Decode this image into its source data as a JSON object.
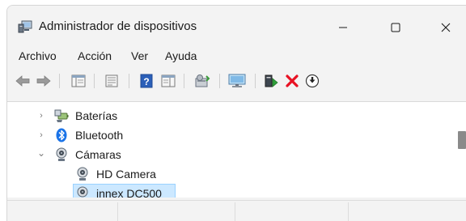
{
  "window": {
    "title": "Administrador de dispositivos"
  },
  "menu": [
    "Archivo",
    "Acción",
    "Ver",
    "Ayuda"
  ],
  "toolbar": {
    "buttons": [
      {
        "icon": "back-arrow-icon"
      },
      {
        "icon": "forward-arrow-icon"
      },
      {
        "icon": "show-hide-console-tree-icon"
      },
      {
        "icon": "properties-icon"
      },
      {
        "icon": "help-icon"
      },
      {
        "icon": "action-pane-icon"
      },
      {
        "icon": "scan-hardware-icon"
      },
      {
        "icon": "monitor-icon"
      },
      {
        "icon": "update-driver-icon"
      },
      {
        "icon": "uninstall-device-icon"
      },
      {
        "icon": "disable-device-icon"
      }
    ]
  },
  "tree": {
    "items": [
      {
        "label": "Baterías",
        "expander": "›",
        "icon": "battery-icon"
      },
      {
        "label": "Bluetooth",
        "expander": "›",
        "icon": "bluetooth-icon"
      },
      {
        "label": "Cámaras",
        "expander": "⌄",
        "icon": "camera-icon"
      },
      {
        "label": "HD Camera",
        "icon": "webcam-icon"
      },
      {
        "label": "innex DC500",
        "icon": "webcam-icon",
        "selected": true
      }
    ]
  },
  "colors": {
    "window_bg": "#f3f3f3",
    "selection_bg": "#cce8ff",
    "selection_border": "#99d1ff",
    "bluetooth_blue": "#1a73e8",
    "uninstall_red": "#e81123",
    "help_blue": "#2b5fb8"
  }
}
